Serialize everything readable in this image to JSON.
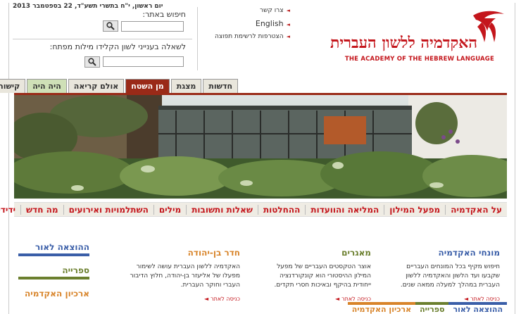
{
  "header": {
    "date": "יום ראשון, י\"ח בתשרי תשע\"ד, 22 בספטמבר 2013",
    "search_label": "חיפוש באתר:",
    "search_value": "",
    "question_label": "לשאלה בענייני לשון הקלידו מילות מפתח:",
    "question_value": "",
    "links": [
      "צרו קשר",
      "English",
      "הצטרפות לרשימת תפוצה"
    ],
    "logo_he": "האקדמיה ללשון העברית",
    "logo_en": "THE ACADEMY OF THE HEBREW LANGUAGE"
  },
  "tabs": [
    {
      "label": "חדשות",
      "state": "normal"
    },
    {
      "label": "מצגת",
      "state": "normal"
    },
    {
      "label": "מן השטח",
      "state": "active"
    },
    {
      "label": "אולם קריאה",
      "state": "normal"
    },
    {
      "label": "היה היה",
      "state": "green"
    },
    {
      "label": "קישורים",
      "state": "normal"
    }
  ],
  "nav": [
    "על האקדמיה",
    "מפעל המילון",
    "המליאה והוועדות",
    "ההחלטות",
    "שאלות ותשובות",
    "מילים",
    "השתלמויות ואירועים",
    "מה חדש",
    "ידידים"
  ],
  "columns": [
    {
      "title": "מונחי האקדמיה",
      "text": "חיפוש מקיף בכל המונחים העבריים שקבעו ועד הלשון והאקדמיה ללשון העברית במהלך למעלה ממאה שנים.",
      "more": "כניסה לאתר",
      "color": "#3a5ea8"
    },
    {
      "title": "מאגרים",
      "text": "אוצר הטקסטים העבריים של מפעל המילון ההיסטורי הוא קונקורדנציה ייחודית בהיקף ובאיכות חסרי תקדים.",
      "more": "כניסה לאתר",
      "color": "#6b7f2e"
    },
    {
      "title": "חדר בן-יהודה",
      "text": "האקדמיה ללשון העברית עושה לשימור מפעלו של אליעזר בן-יהודה, חלוץ הדיבור העברי וחוקר העברית.",
      "more": "כניסה לאתר",
      "color": "#d8842a"
    }
  ],
  "side": [
    {
      "title": "ההוצאה לאור",
      "color": "#3a5ea8"
    },
    {
      "title": "ספרייה",
      "color": "#6b7f2e"
    },
    {
      "title": "ארכיון האקדמיה",
      "color": "#d8842a"
    }
  ],
  "bottom_tabs": [
    {
      "label": "ההוצאה לאור",
      "color": "#3a5ea8"
    },
    {
      "label": "ספרייה",
      "color": "#6b7f2e"
    },
    {
      "label": "ארכיון האקדמיה",
      "color": "#d8842a"
    }
  ],
  "colors": {
    "brand_red": "#c4161c",
    "tab_active": "#9a2a18"
  }
}
